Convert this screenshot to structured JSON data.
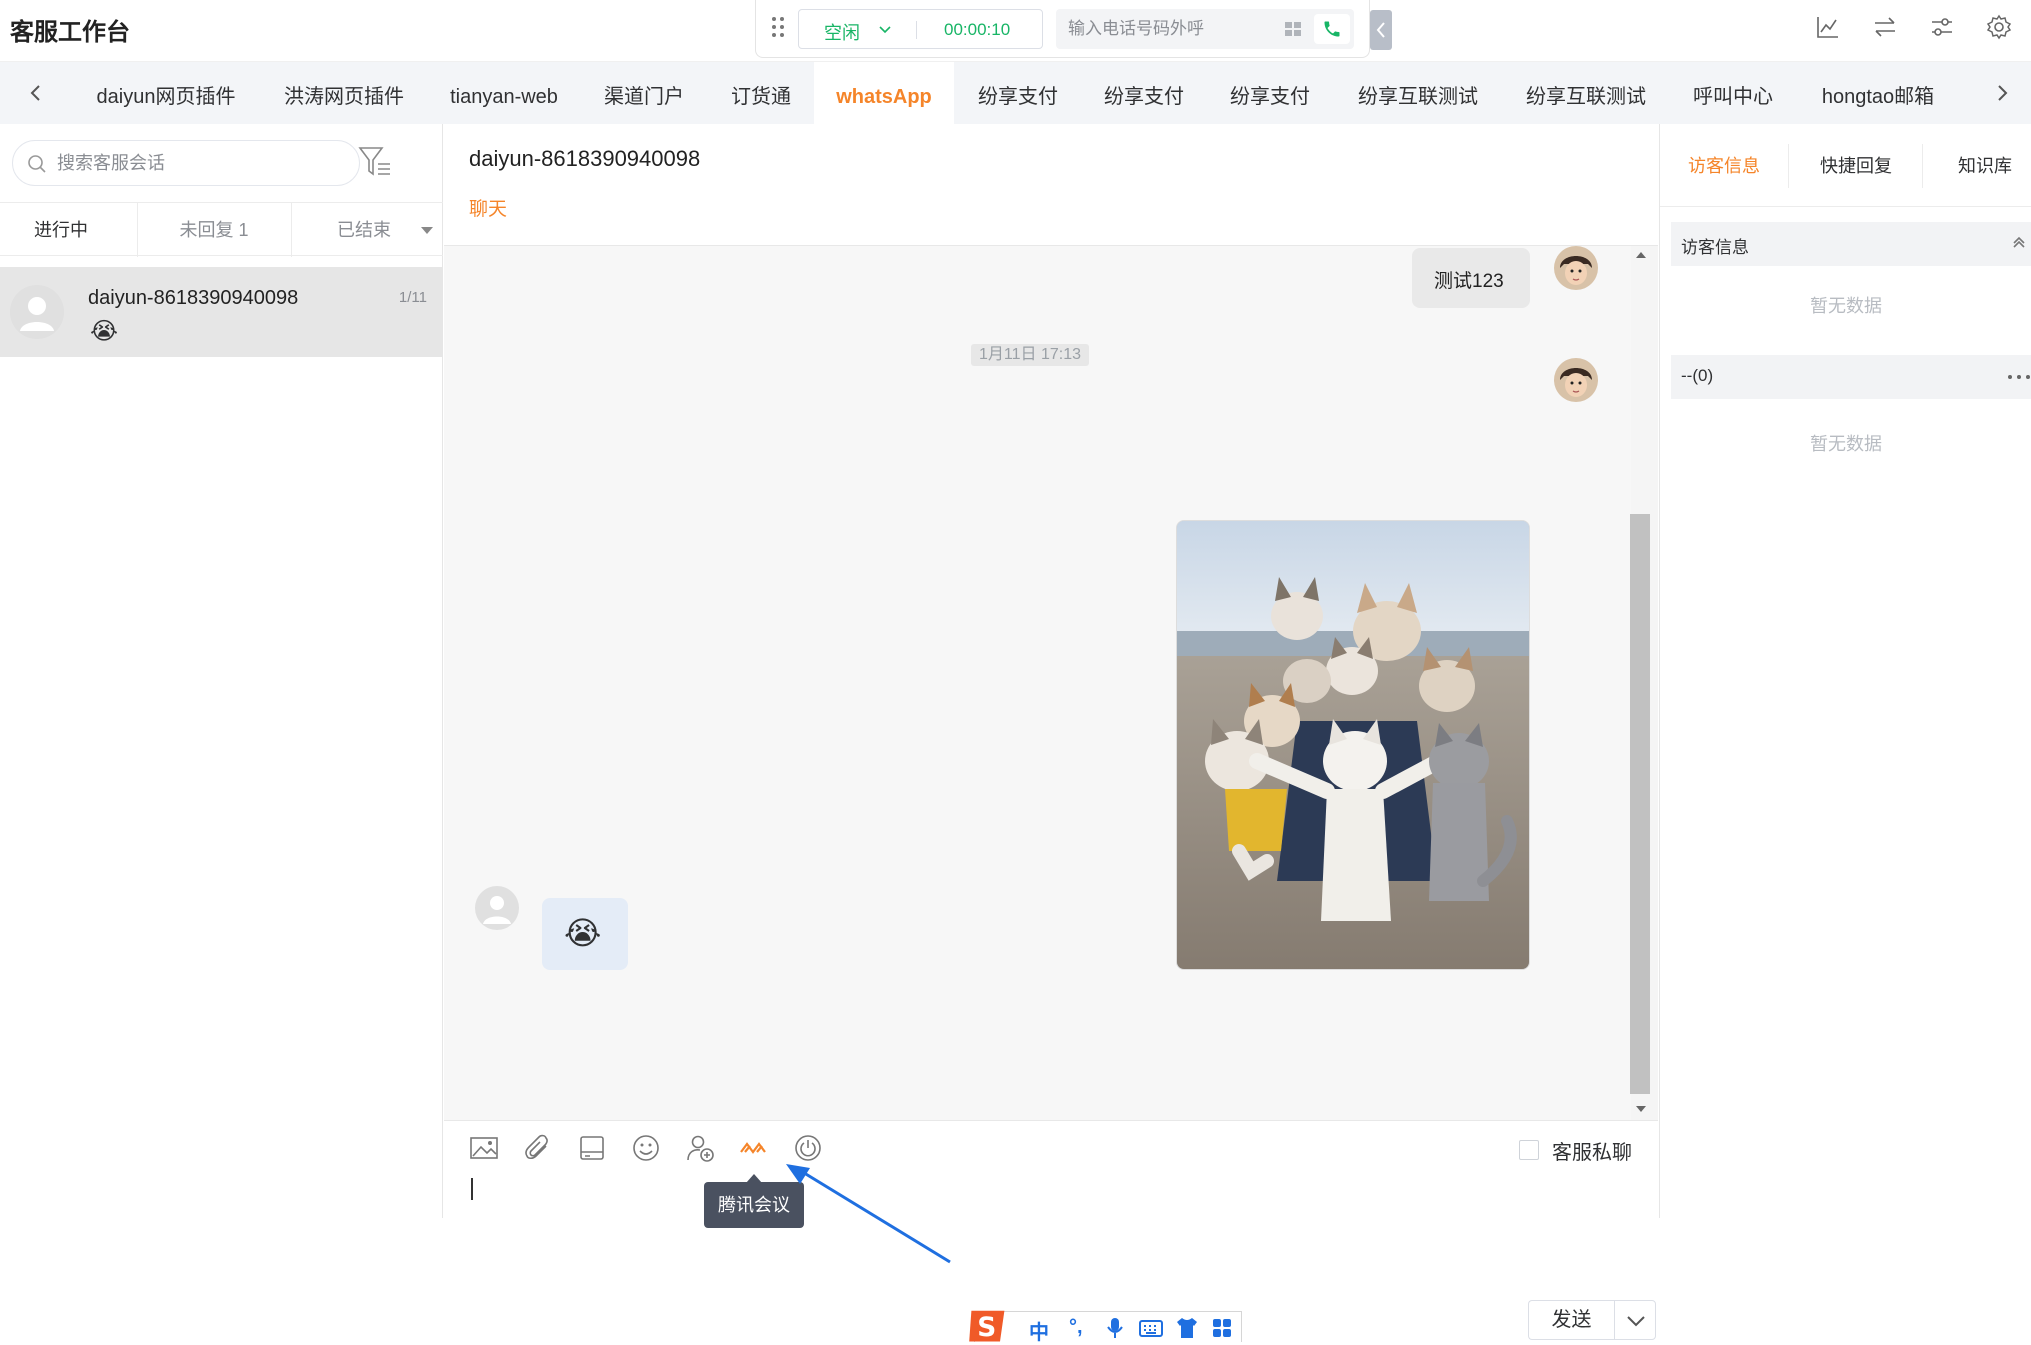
{
  "app": {
    "title": "客服工作台"
  },
  "phone": {
    "status": "空闲",
    "timer": "00:00:10",
    "dial_placeholder": "输入电话号码外呼"
  },
  "tabs": [
    {
      "label": "daiyun网页插件"
    },
    {
      "label": "洪涛网页插件"
    },
    {
      "label": "tianyan-web"
    },
    {
      "label": "渠道门户"
    },
    {
      "label": "订货通"
    },
    {
      "label": "whatsApp"
    },
    {
      "label": "纷享支付"
    },
    {
      "label": "纷享支付"
    },
    {
      "label": "纷享支付"
    },
    {
      "label": "纷享互联测试"
    },
    {
      "label": "纷享互联测试"
    },
    {
      "label": "呼叫中心"
    },
    {
      "label": "hongtao邮箱"
    }
  ],
  "sidebar": {
    "search_placeholder": "搜索客服会话",
    "tabs": [
      "进行中",
      "未回复 1",
      "已结束"
    ],
    "session": {
      "name": "daiyun-8618390940098",
      "count": "1/11",
      "preview": "😭"
    }
  },
  "chat": {
    "title": "daiyun-8618390940098",
    "subtitle": "聊天",
    "messages": {
      "text_out": "测试123",
      "timestamp": "1月11日 17:13",
      "emoji_in": "😭"
    },
    "tooltip": "腾讯会议",
    "private_label": "客服私聊",
    "send_label": "发送"
  },
  "ime": {
    "lang": "中",
    "punct": "°,"
  },
  "right_panel": {
    "tabs": [
      "访客信息",
      "快捷回复",
      "知识库"
    ],
    "section1_title": "访客信息",
    "section1_empty": "暂无数据",
    "section2_title": "--(0)",
    "section2_empty": "暂无数据"
  },
  "colors": {
    "accent": "#f5852a",
    "status_green": "#18b566",
    "tooltip_bg": "#4a5160",
    "annotation_blue": "#1f6fe0"
  }
}
